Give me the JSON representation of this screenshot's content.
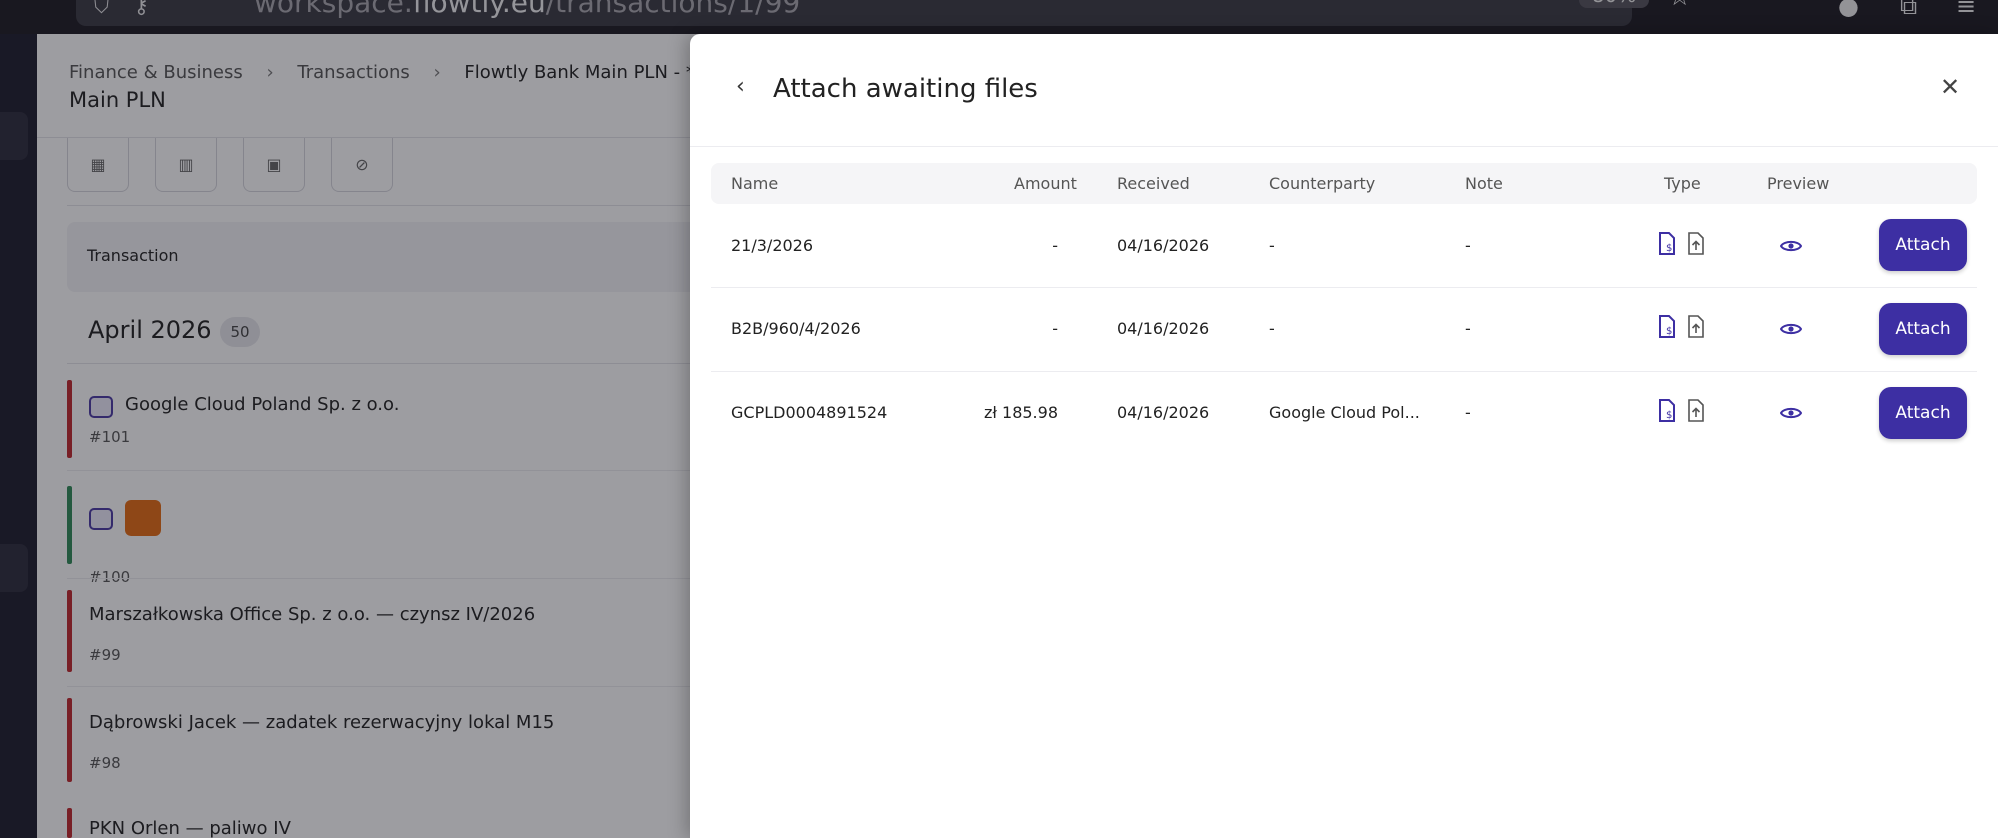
{
  "browser": {
    "url_prefix": "workspace.",
    "url_domain": "flowtly.eu",
    "url_path": "/transactions/1/99",
    "zoom": "80%"
  },
  "app": {
    "breadcrumb": [
      "Finance & Business",
      "Transactions",
      "Flowtly Bank Main PLN - ****"
    ],
    "subtitle": "Main PLN",
    "table_header": "Transaction",
    "month_label": "April 2026",
    "month_count": "50",
    "transactions": [
      {
        "title": "Google Cloud Poland Sp. z o.o.",
        "number": "#101",
        "status": "expense"
      },
      {
        "title": "",
        "number": "#100",
        "status": "income"
      },
      {
        "title": "Marszałkowska Office Sp. z o.o. — czynsz IV/2026",
        "number": "#99",
        "status": "expense"
      },
      {
        "title": "Dąbrowski Jacek — zadatek rezerwacyjny lokal M15",
        "number": "#98",
        "status": "expense"
      },
      {
        "title": "PKN Orlen — paliwo IV",
        "number": "",
        "status": "expense"
      }
    ]
  },
  "drawer": {
    "title": "Attach awaiting files",
    "columns": {
      "name": "Name",
      "amount": "Amount",
      "received": "Received",
      "counterparty": "Counterparty",
      "note": "Note",
      "type": "Type",
      "preview": "Preview"
    },
    "rows": [
      {
        "name": "21/3/2026",
        "amount": "-",
        "received": "04/16/2026",
        "counterparty": "-",
        "note": "-",
        "action": "Attach"
      },
      {
        "name": "B2B/960/4/2026",
        "amount": "-",
        "received": "04/16/2026",
        "counterparty": "-",
        "note": "-",
        "action": "Attach"
      },
      {
        "name": "GCPLD0004891524",
        "amount": "zł 185.98",
        "received": "04/16/2026",
        "counterparty": "Google Cloud Pol...",
        "note": "-",
        "action": "Attach"
      }
    ]
  },
  "colors": {
    "accent": "#3d2fa3",
    "expense_bar": "#c0262c",
    "income_bar": "#2f8a57",
    "orange_tile": "#e56b12"
  }
}
